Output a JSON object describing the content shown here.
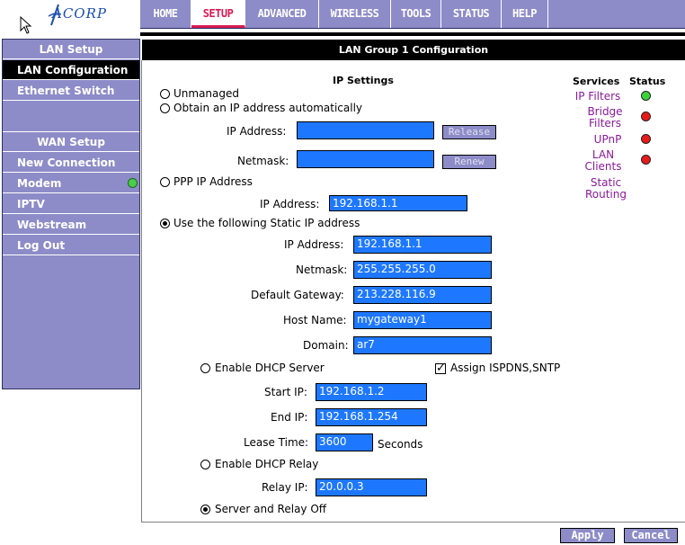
{
  "brand": {
    "logo_text": "ACORP"
  },
  "topnav": [
    {
      "label": "HOME"
    },
    {
      "label": "SETUP"
    },
    {
      "label": "ADVANCED"
    },
    {
      "label": "WIRELESS"
    },
    {
      "label": "TOOLS"
    },
    {
      "label": "STATUS"
    },
    {
      "label": "HELP"
    }
  ],
  "sidebar": {
    "lan_header": "LAN Setup",
    "lan_items": [
      "LAN Configuration",
      "Ethernet Switch"
    ],
    "wan_header": "WAN Setup",
    "wan_items": [
      "New Connection",
      "Modem",
      "IPTV",
      "Webstream",
      "Log Out"
    ]
  },
  "main": {
    "title": "LAN Group 1 Configuration",
    "section": "IP Settings",
    "unmanaged": "Unmanaged",
    "obtain_auto": "Obtain an IP address automatically",
    "ip_address_label": "IP Address:",
    "netmask_label": "Netmask:",
    "release_btn": "Release",
    "renew_btn": "Renew",
    "ppp": "PPP IP Address",
    "ppp_ip": "192.168.1.1",
    "static": "Use the following Static IP address",
    "static_ip": "192.168.1.1",
    "static_netmask": "255.255.255.0",
    "gateway_label": "Default Gateway:",
    "gateway": "213.228.116.9",
    "host_label": "Host Name:",
    "host": "mygateway1",
    "domain_label": "Domain:",
    "domain": "ar7",
    "dhcp_server": "Enable DHCP Server",
    "assign": "Assign ISPDNS,SNTP",
    "start_label": "Start IP:",
    "start_ip": "192.168.1.2",
    "end_label": "End IP:",
    "end_ip": "192.168.1.254",
    "lease_label": "Lease Time:",
    "lease": "3600",
    "seconds": "Seconds",
    "dhcp_relay": "Enable DHCP Relay",
    "relay_label": "Relay IP:",
    "relay_ip": "20.0.0.3",
    "off": "Server and Relay Off"
  },
  "services": {
    "header_services": "Services",
    "header_status": "Status",
    "ip_filters": "IP Filters",
    "bridge_filters_1": "Bridge",
    "bridge_filters_2": "Filters",
    "upnp": "UPnP",
    "lan_clients_1": "LAN",
    "lan_clients_2": "Clients",
    "static_routing_1": "Static",
    "static_routing_2": "Routing",
    "status_colors": {
      "green": "#3ad43a",
      "red": "#e81a1a"
    }
  },
  "footer": {
    "apply": "Apply",
    "cancel": "Cancel"
  }
}
